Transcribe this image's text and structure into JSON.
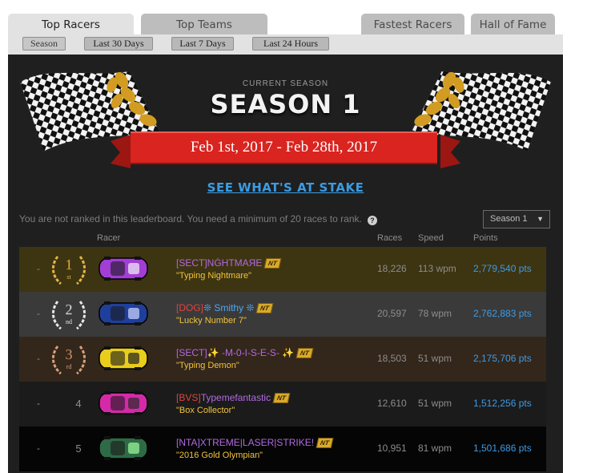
{
  "tabs": [
    {
      "label": "Top Racers",
      "active": true
    },
    {
      "label": "Top Teams",
      "active": false
    },
    {
      "label": "Fastest Racers",
      "active": false
    },
    {
      "label": "Hall of Fame",
      "active": false
    }
  ],
  "periods": [
    "Season",
    "Last 30 Days",
    "Last 7 Days",
    "Last 24 Hours"
  ],
  "banner": {
    "label": "CURRENT SEASON",
    "season": "SEASON 1",
    "dates": "Feb 1st, 2017 - Feb 28th, 2017",
    "stake_link": "SEE WHAT'S AT STAKE"
  },
  "notice": "You are not ranked in this leaderboard. You need a minimum of 20 races to rank.",
  "season_select": "Season 1",
  "columns": {
    "racer": "Racer",
    "races": "Races",
    "speed": "Speed",
    "points": "Points"
  },
  "badge_text": "NT",
  "rows": [
    {
      "change": "-",
      "rank": "1",
      "suffix": "st",
      "tag": "[SECT]",
      "name": "NĠHTMAЯE",
      "title": "\"Typing Nightmare\"",
      "races": "18,226",
      "speed": "113 wpm",
      "points": "2,779,540 pts",
      "tag_color": "#b26ae0",
      "name_color": "#b26ae0",
      "bg": "#3d3411",
      "car": "purple",
      "medal": "gold"
    },
    {
      "change": "-",
      "rank": "2",
      "suffix": "nd",
      "tag": "[DOG]",
      "name": "❊ Smithy ❊",
      "title": "\"Lucky Number 7\"",
      "races": "20,597",
      "speed": "78 wpm",
      "points": "2,762,883 pts",
      "tag_color": "#e0443c",
      "name_color": "#4fa7f0",
      "bg": "#3a3a3a",
      "car": "blue",
      "medal": "silver"
    },
    {
      "change": "-",
      "rank": "3",
      "suffix": "rd",
      "tag": "[SECT]",
      "name": "✨ -M-0-I-S-E-S- ✨",
      "title": "\"Typing Demon\"",
      "races": "18,503",
      "speed": "51 wpm",
      "points": "2,175,706 pts",
      "tag_color": "#b26ae0",
      "name_color": "#b26ae0",
      "bg": "#33261b",
      "car": "yellow",
      "medal": "bronze"
    },
    {
      "change": "-",
      "rank": "4",
      "suffix": "",
      "tag": "[BVS]",
      "name": "Typemefantastic",
      "title": "\"Box Collector\"",
      "races": "12,610",
      "speed": "51 wpm",
      "points": "1,512,256 pts",
      "tag_color": "#e0443c",
      "name_color": "#b26ae0",
      "bg": "#1b1b1b",
      "car": "pink",
      "medal": ""
    },
    {
      "change": "-",
      "rank": "5",
      "suffix": "",
      "tag": "[NTA]",
      "name": "XTREME|LASER|STRIKE!",
      "title": "\"2016 Gold Olympian\"",
      "races": "10,951",
      "speed": "81 wpm",
      "points": "1,501,686 pts",
      "tag_color": "#b26ae0",
      "name_color": "#b26ae0",
      "bg": "#050505",
      "car": "green",
      "medal": ""
    }
  ]
}
